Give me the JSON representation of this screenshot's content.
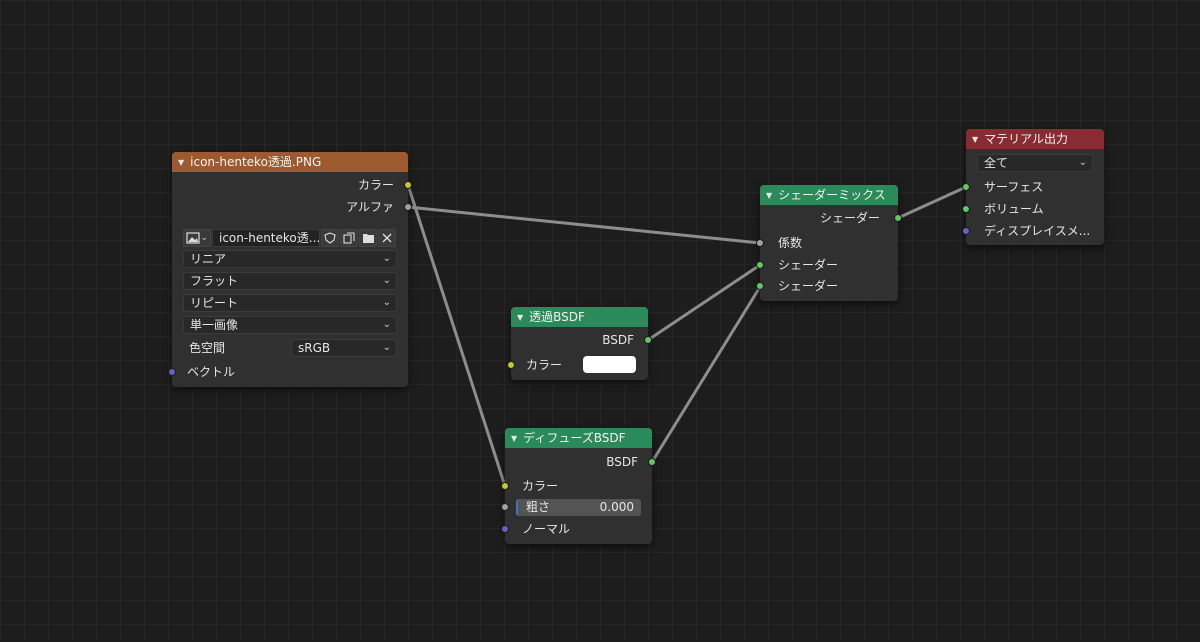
{
  "colors": {
    "color_socket": "#c7c729",
    "gray_socket": "#a1a1a1",
    "shader_socket": "#63c763",
    "vector_socket": "#6363c7",
    "image_header": "#9c5a2e",
    "shader_header": "#2b8a5a",
    "output_header": "#892b32"
  },
  "image_node": {
    "title": "icon-henteko透過.PNG",
    "outputs": {
      "color": "カラー",
      "alpha": "アルファ"
    },
    "image_name": "icon-henteko透...",
    "interpolation": "リニア",
    "projection": "フラット",
    "extension": "リピート",
    "source": "単一画像",
    "colorspace_label": "色空間",
    "colorspace_value": "sRGB",
    "vector_label": "ベクトル"
  },
  "transparent_node": {
    "title": "透過BSDF",
    "output": "BSDF",
    "color_label": "カラー",
    "color_value": "#ffffff"
  },
  "diffuse_node": {
    "title": "ディフューズBSDF",
    "output": "BSDF",
    "color_label": "カラー",
    "roughness_label": "粗さ",
    "roughness_value": "0.000",
    "normal_label": "ノーマル"
  },
  "mix_node": {
    "title": "シェーダーミックス",
    "output": "シェーダー",
    "fac_label": "係数",
    "shader1_label": "シェーダー",
    "shader2_label": "シェーダー"
  },
  "output_node": {
    "title": "マテリアル出力",
    "target": "全て",
    "surface_label": "サーフェス",
    "volume_label": "ボリューム",
    "displacement_label": "ディスプレイスメ..."
  }
}
